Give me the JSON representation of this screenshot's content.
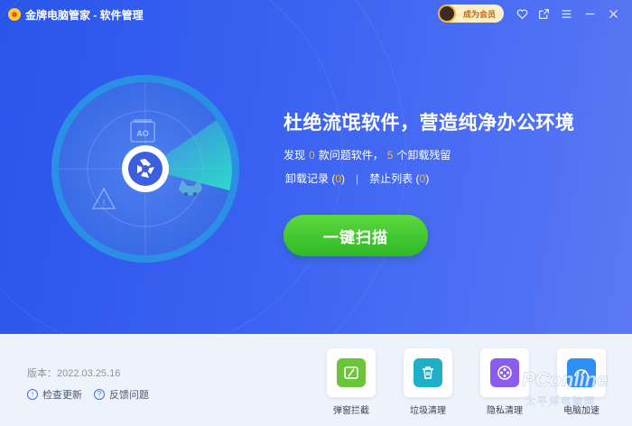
{
  "window": {
    "title": "金牌电脑管家 - 软件管理",
    "member_label": "成为会员"
  },
  "hero": {
    "headline": "杜绝流氓软件，营造纯净办公环境",
    "stats": {
      "prefix": "发现",
      "problem_count": "0",
      "middle": "款问题软件，",
      "residue_count": "5",
      "suffix": "个卸载残留"
    },
    "links": {
      "uninstall_label": "卸载记录",
      "uninstall_count": "0",
      "separator": "|",
      "blocklist_label": "禁止列表",
      "blocklist_count": "0"
    },
    "scan_button": "一键扫描",
    "radar_tag": "AO"
  },
  "footer": {
    "version": "版本：2022.03.25.16",
    "check_update": "检查更新",
    "feedback": "反馈问题",
    "tools": [
      {
        "label": "弹窗拦截",
        "icon": "popup-block-icon",
        "color": "#6cc43a"
      },
      {
        "label": "垃圾清理",
        "icon": "trash-icon",
        "color": "#1fb0c8"
      },
      {
        "label": "隐私清理",
        "icon": "privacy-reel-icon",
        "color": "#8a5cf0"
      },
      {
        "label": "电脑加速",
        "icon": "speed-gauge-icon",
        "color": "#2f8ff5"
      }
    ]
  },
  "watermark": {
    "brand": "PConline",
    "sub": "太平洋电脑网"
  },
  "colors": {
    "hero_start": "#2a55ea",
    "hero_end": "#5a78f5",
    "accent_orange": "#ffb020",
    "scan_green": "#3fc52e",
    "radar_teal": "#2fe0c8"
  }
}
